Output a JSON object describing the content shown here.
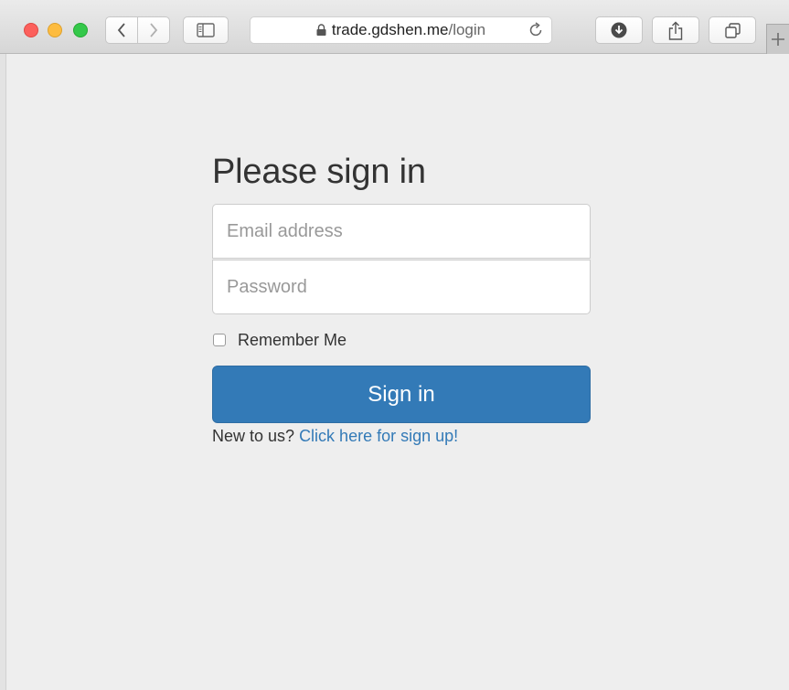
{
  "browser": {
    "url_host": "trade.gdshen.me",
    "url_path": "/login",
    "icons": [
      "close-icon",
      "minimize-icon",
      "zoom-icon",
      "chevron-left-icon",
      "chevron-right-icon",
      "sidebar-icon",
      "lock-icon",
      "reload-icon",
      "download-icon",
      "share-icon",
      "tabs-icon",
      "plus-icon"
    ]
  },
  "form": {
    "heading": "Please sign in",
    "email_placeholder": "Email address",
    "email_value": "",
    "password_placeholder": "Password",
    "password_value": "",
    "remember_label": "Remember Me",
    "remember_checked": false,
    "submit_label": "Sign in",
    "signup_prompt": "New to us?",
    "signup_link": "Click here for sign up!"
  },
  "colors": {
    "primary": "#337ab7",
    "background": "#eeeeee",
    "text": "#333333"
  }
}
